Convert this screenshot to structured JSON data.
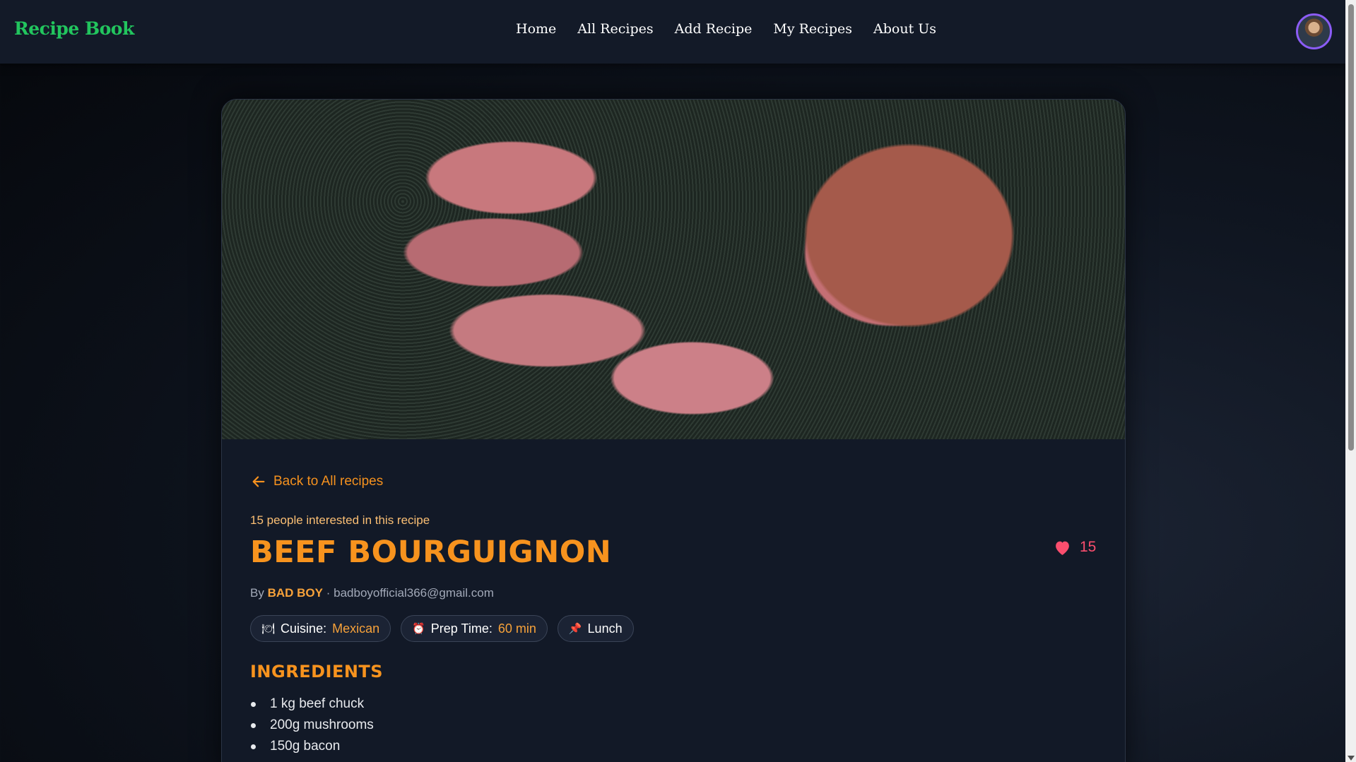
{
  "navbar": {
    "logo": "Recipe Book",
    "links": [
      "Home",
      "All Recipes",
      "Add Recipe",
      "My Recipes",
      "About Us"
    ]
  },
  "recipe": {
    "back_label": "Back to All recipes",
    "interest_text": "15 people interested in this recipe",
    "title": "Beef Bourguignon",
    "likes": "15",
    "author_prefix": "By",
    "author_name": "BAD BOY",
    "author_separator": "·",
    "author_email": "badboyofficial366@gmail.com",
    "tags": [
      {
        "icon": "plate-icon",
        "glyph": "🍽",
        "label": "Cuisine:",
        "value": "Mexican"
      },
      {
        "icon": "alarm-clock-icon",
        "glyph": "⏰",
        "label": "Prep Time:",
        "value": "60 min"
      },
      {
        "icon": "pin-icon",
        "glyph": "📌",
        "label": "Lunch",
        "value": ""
      }
    ],
    "ingredients_title": "Ingredients",
    "ingredients": [
      "1 kg beef chuck",
      "200g mushrooms",
      "150g bacon"
    ]
  },
  "colors": {
    "accent": "#f7931e",
    "logo_green": "#22c55e",
    "like_red": "#fb4e6e",
    "avatar_ring": "#8b5cf6"
  }
}
